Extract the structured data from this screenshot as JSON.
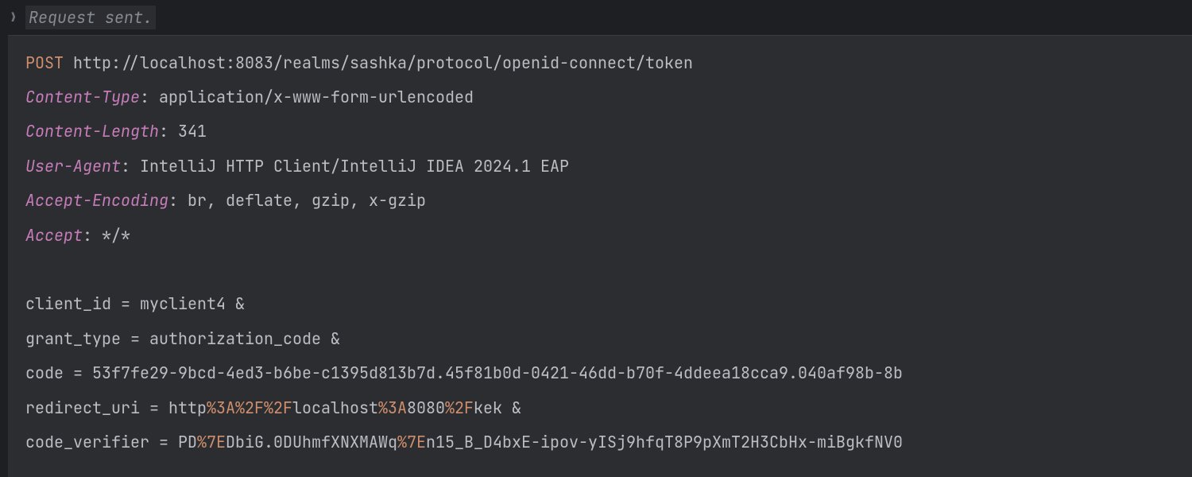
{
  "collapsed_section_label": "Request sent.",
  "request": {
    "method": "POST",
    "url": "http://localhost:8083/realms/sashka/protocol/openid-connect/token",
    "headers": [
      {
        "name": "Content-Type",
        "value": "application/x-www-form-urlencoded"
      },
      {
        "name": "Content-Length",
        "value": "341"
      },
      {
        "name": "User-Agent",
        "value": "IntelliJ HTTP Client/IntelliJ IDEA 2024.1 EAP"
      },
      {
        "name": "Accept-Encoding",
        "value": "br, deflate, gzip, x-gzip"
      },
      {
        "name": "Accept",
        "value": "*/*"
      }
    ],
    "body_lines": [
      [
        {
          "t": "client_id = myclient4 &",
          "cls": "body-text"
        }
      ],
      [
        {
          "t": "grant_type = authorization_code &",
          "cls": "body-text"
        }
      ],
      [
        {
          "t": "code = 53f7fe29-9bcd-4ed3-b6be-c1395d813b7d.45f81b0d-0421-46dd-b70f-4ddeea18cca9.040af98b-8b",
          "cls": "body-text"
        }
      ],
      [
        {
          "t": "redirect_uri = http",
          "cls": "body-text"
        },
        {
          "t": "%3A%2F%2F",
          "cls": "body-enc"
        },
        {
          "t": "localhost",
          "cls": "body-text"
        },
        {
          "t": "%3A",
          "cls": "body-enc"
        },
        {
          "t": "8080",
          "cls": "body-text"
        },
        {
          "t": "%2F",
          "cls": "body-enc"
        },
        {
          "t": "kek &",
          "cls": "body-text"
        }
      ],
      [
        {
          "t": "code_verifier = PD",
          "cls": "body-text"
        },
        {
          "t": "%7E",
          "cls": "body-enc"
        },
        {
          "t": "DbiG.0DUhmfXNXMAWq",
          "cls": "body-text"
        },
        {
          "t": "%7E",
          "cls": "body-enc"
        },
        {
          "t": "n15_B_D4bxE-ipov-yISj9hfqT8P9pXmT2H3CbHx-miBgkfNV0",
          "cls": "body-text"
        }
      ]
    ]
  }
}
